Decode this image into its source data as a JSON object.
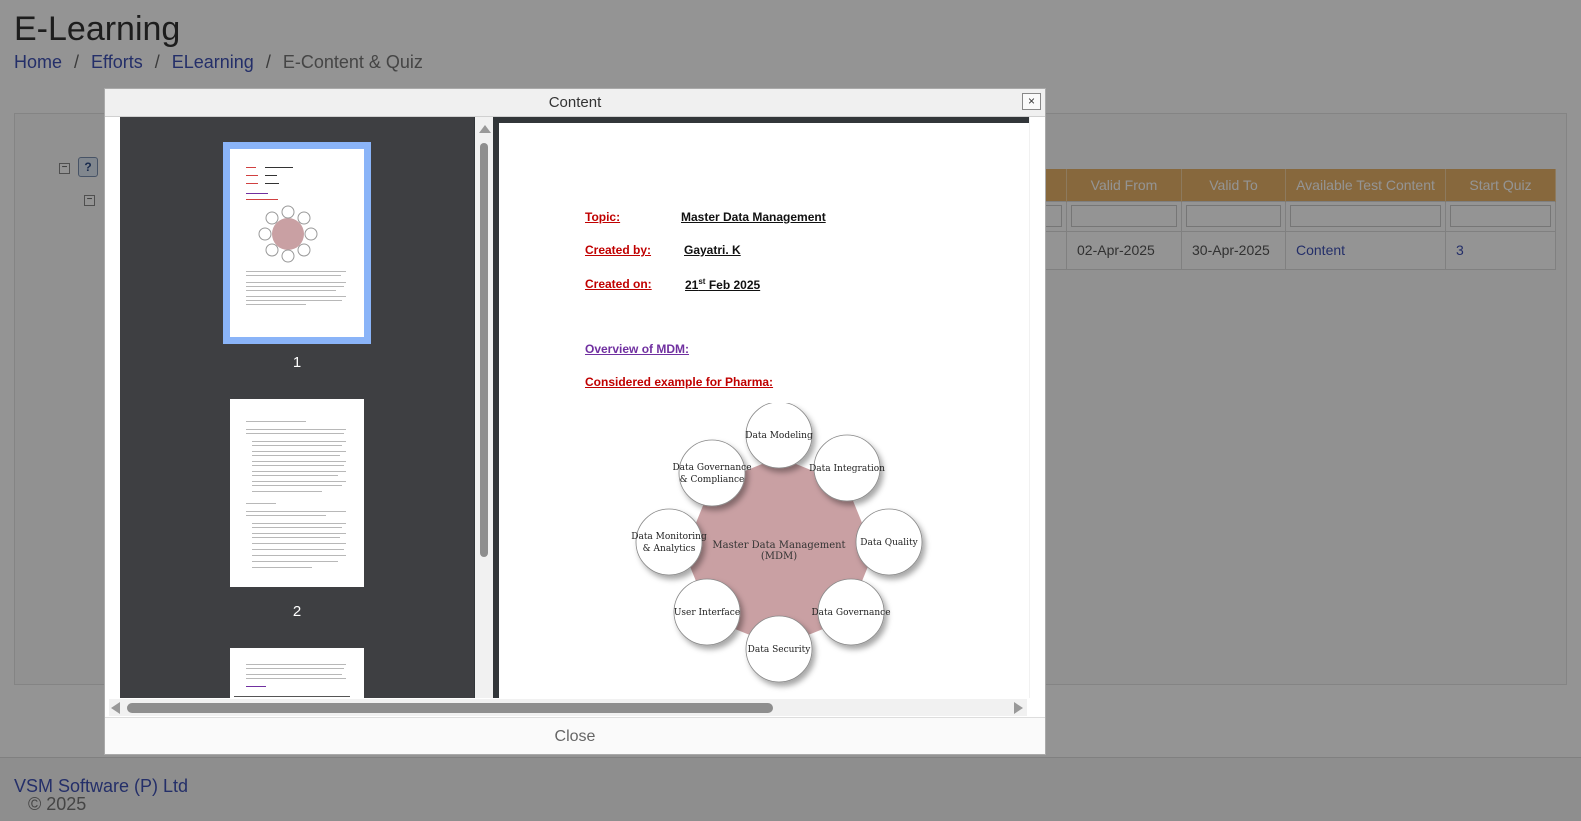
{
  "page": {
    "title": "E-Learning",
    "breadcrumb": [
      "Home",
      "Efforts",
      "ELearning",
      "E-Content & Quiz"
    ],
    "breadcrumb_sep": "/"
  },
  "grid": {
    "headers": [
      "Valid From",
      "Valid To",
      "Available Test Content",
      "Start Quiz"
    ],
    "row": {
      "valid_from": "02-Apr-2025",
      "valid_to": "30-Apr-2025",
      "content_link": "Content",
      "quiz_count": "3"
    }
  },
  "footer": {
    "copyright": "© 2025",
    "company": "VSM Software (P) Ltd"
  },
  "dialog": {
    "title": "Content",
    "close_x": "×",
    "close_label": "Close"
  },
  "viewer": {
    "thumbnails": [
      {
        "label": "1"
      },
      {
        "label": "2"
      }
    ],
    "document": {
      "topic_label": "Topic:",
      "topic_value": "Master Data Management",
      "created_by_label": "Created by:",
      "created_by_value": "Gayatri. K",
      "created_on_label": "Created on:",
      "created_on_day": "21",
      "created_on_sup": "st",
      "created_on_rest": " Feb 2025",
      "overview": "Overview of MDM:",
      "example": "Considered example for Pharma:",
      "diagram": {
        "center_line1": "Master Data Management",
        "center_line2": "(MDM)",
        "nodes": [
          [
            "Data Modeling"
          ],
          [
            "Data Integration"
          ],
          [
            "Data Quality"
          ],
          [
            "Data Governance"
          ],
          [
            "Data Security"
          ],
          [
            "User Interface"
          ],
          [
            "Data Monitoring",
            "& Analytics"
          ],
          [
            "Data Governance",
            "& Compliance"
          ]
        ]
      }
    }
  },
  "colors": {
    "header_accent": "#e8b46a",
    "link": "#3f51b5",
    "label_red": "#c00000",
    "heading_purple": "#7030a0",
    "center_fill": "#c9a0a3"
  }
}
